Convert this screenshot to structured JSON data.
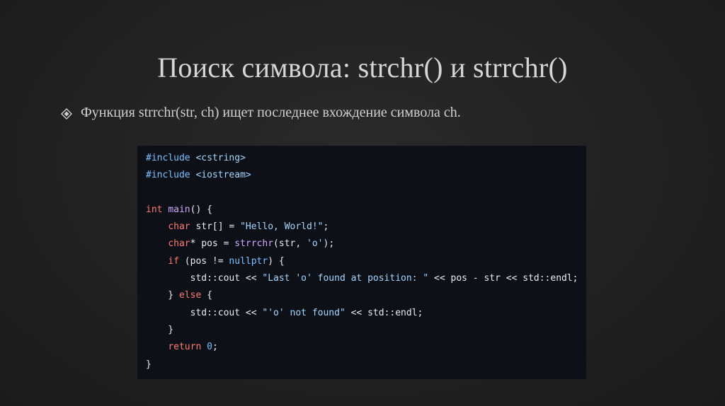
{
  "slide": {
    "title": "Поиск символа: strchr() и strrchr()",
    "bullet": {
      "icon": "diamond-bullet-icon",
      "text": "Функция strrchr(str, ch) ищет последнее вхождение символа ch."
    }
  },
  "code": {
    "lines": [
      [
        {
          "t": "#include ",
          "c": "pp"
        },
        {
          "t": "<cstring>",
          "c": "str"
        }
      ],
      [
        {
          "t": "#include ",
          "c": "pp"
        },
        {
          "t": "<iostream>",
          "c": "str"
        }
      ],
      [],
      [
        {
          "t": "int",
          "c": "kw"
        },
        {
          "t": " ",
          "c": "plain"
        },
        {
          "t": "main",
          "c": "fn"
        },
        {
          "t": "() {",
          "c": "plain"
        }
      ],
      [
        {
          "t": "    ",
          "c": "plain"
        },
        {
          "t": "char",
          "c": "kw"
        },
        {
          "t": " str[] = ",
          "c": "plain"
        },
        {
          "t": "\"Hello, World!\"",
          "c": "str"
        },
        {
          "t": ";",
          "c": "plain"
        }
      ],
      [
        {
          "t": "    ",
          "c": "plain"
        },
        {
          "t": "char",
          "c": "kw"
        },
        {
          "t": "* pos = ",
          "c": "plain"
        },
        {
          "t": "strrchr",
          "c": "fn"
        },
        {
          "t": "(str, ",
          "c": "plain"
        },
        {
          "t": "'o'",
          "c": "str"
        },
        {
          "t": ");",
          "c": "plain"
        }
      ],
      [
        {
          "t": "    ",
          "c": "plain"
        },
        {
          "t": "if",
          "c": "kw"
        },
        {
          "t": " (pos != ",
          "c": "plain"
        },
        {
          "t": "nullptr",
          "c": "pp"
        },
        {
          "t": ") {",
          "c": "plain"
        }
      ],
      [
        {
          "t": "        std::cout << ",
          "c": "plain"
        },
        {
          "t": "\"Last 'o' found at position: \"",
          "c": "str"
        },
        {
          "t": " << pos - str << std::endl;",
          "c": "plain"
        }
      ],
      [
        {
          "t": "    } ",
          "c": "plain"
        },
        {
          "t": "else",
          "c": "kw"
        },
        {
          "t": " {",
          "c": "plain"
        }
      ],
      [
        {
          "t": "        std::cout << ",
          "c": "plain"
        },
        {
          "t": "\"'o' not found\"",
          "c": "str"
        },
        {
          "t": " << std::endl;",
          "c": "plain"
        }
      ],
      [
        {
          "t": "    }",
          "c": "plain"
        }
      ],
      [
        {
          "t": "    ",
          "c": "plain"
        },
        {
          "t": "return",
          "c": "kw"
        },
        {
          "t": " ",
          "c": "plain"
        },
        {
          "t": "0",
          "c": "num"
        },
        {
          "t": ";",
          "c": "plain"
        }
      ],
      [
        {
          "t": "}",
          "c": "plain"
        }
      ]
    ]
  },
  "colors": {
    "background": "#222222",
    "code_background": "#0d1117",
    "keyword": "#ff7b72",
    "preprocessor": "#79c0ff",
    "string": "#a5d6ff",
    "function": "#d2a8ff"
  }
}
